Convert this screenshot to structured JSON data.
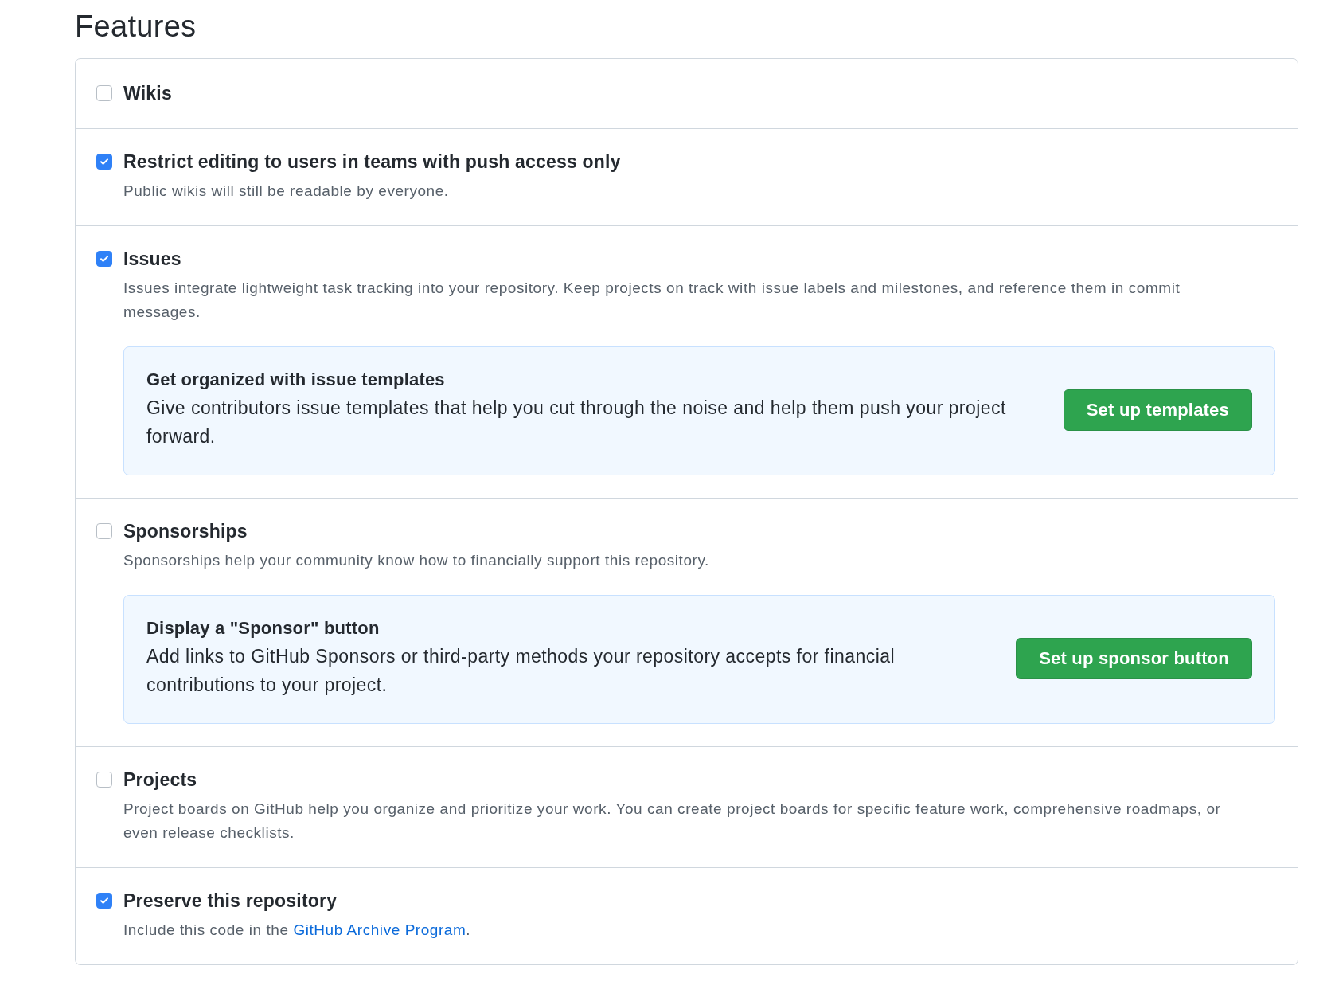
{
  "heading": "Features",
  "features": [
    {
      "title": "Wikis",
      "checked": false
    },
    {
      "title": "Restrict editing to users in teams with push access only",
      "checked": true,
      "description": "Public wikis will still be readable by everyone."
    },
    {
      "title": "Issues",
      "checked": true,
      "description": "Issues integrate lightweight task tracking into your repository. Keep projects on track with issue labels and milestones, and reference them in commit messages.",
      "promo": {
        "title": "Get organized with issue templates",
        "text": "Give contributors issue templates that help you cut through the noise and help them push your project forward.",
        "button": "Set up templates"
      }
    },
    {
      "title": "Sponsorships",
      "checked": false,
      "description": "Sponsorships help your community know how to financially support this repository.",
      "promo": {
        "title": "Display a \"Sponsor\" button",
        "text": "Add links to GitHub Sponsors or third-party methods your repository accepts for financial contributions to your project.",
        "button": "Set up sponsor button"
      }
    },
    {
      "title": "Projects",
      "checked": false,
      "description": "Project boards on GitHub help you organize and prioritize your work. You can create project boards for specific feature work, comprehensive roadmaps, or even release checklists."
    },
    {
      "title": "Preserve this repository",
      "checked": true,
      "description": "Include this code in the ",
      "link": "GitHub Archive Program",
      "after_link": "."
    }
  ]
}
